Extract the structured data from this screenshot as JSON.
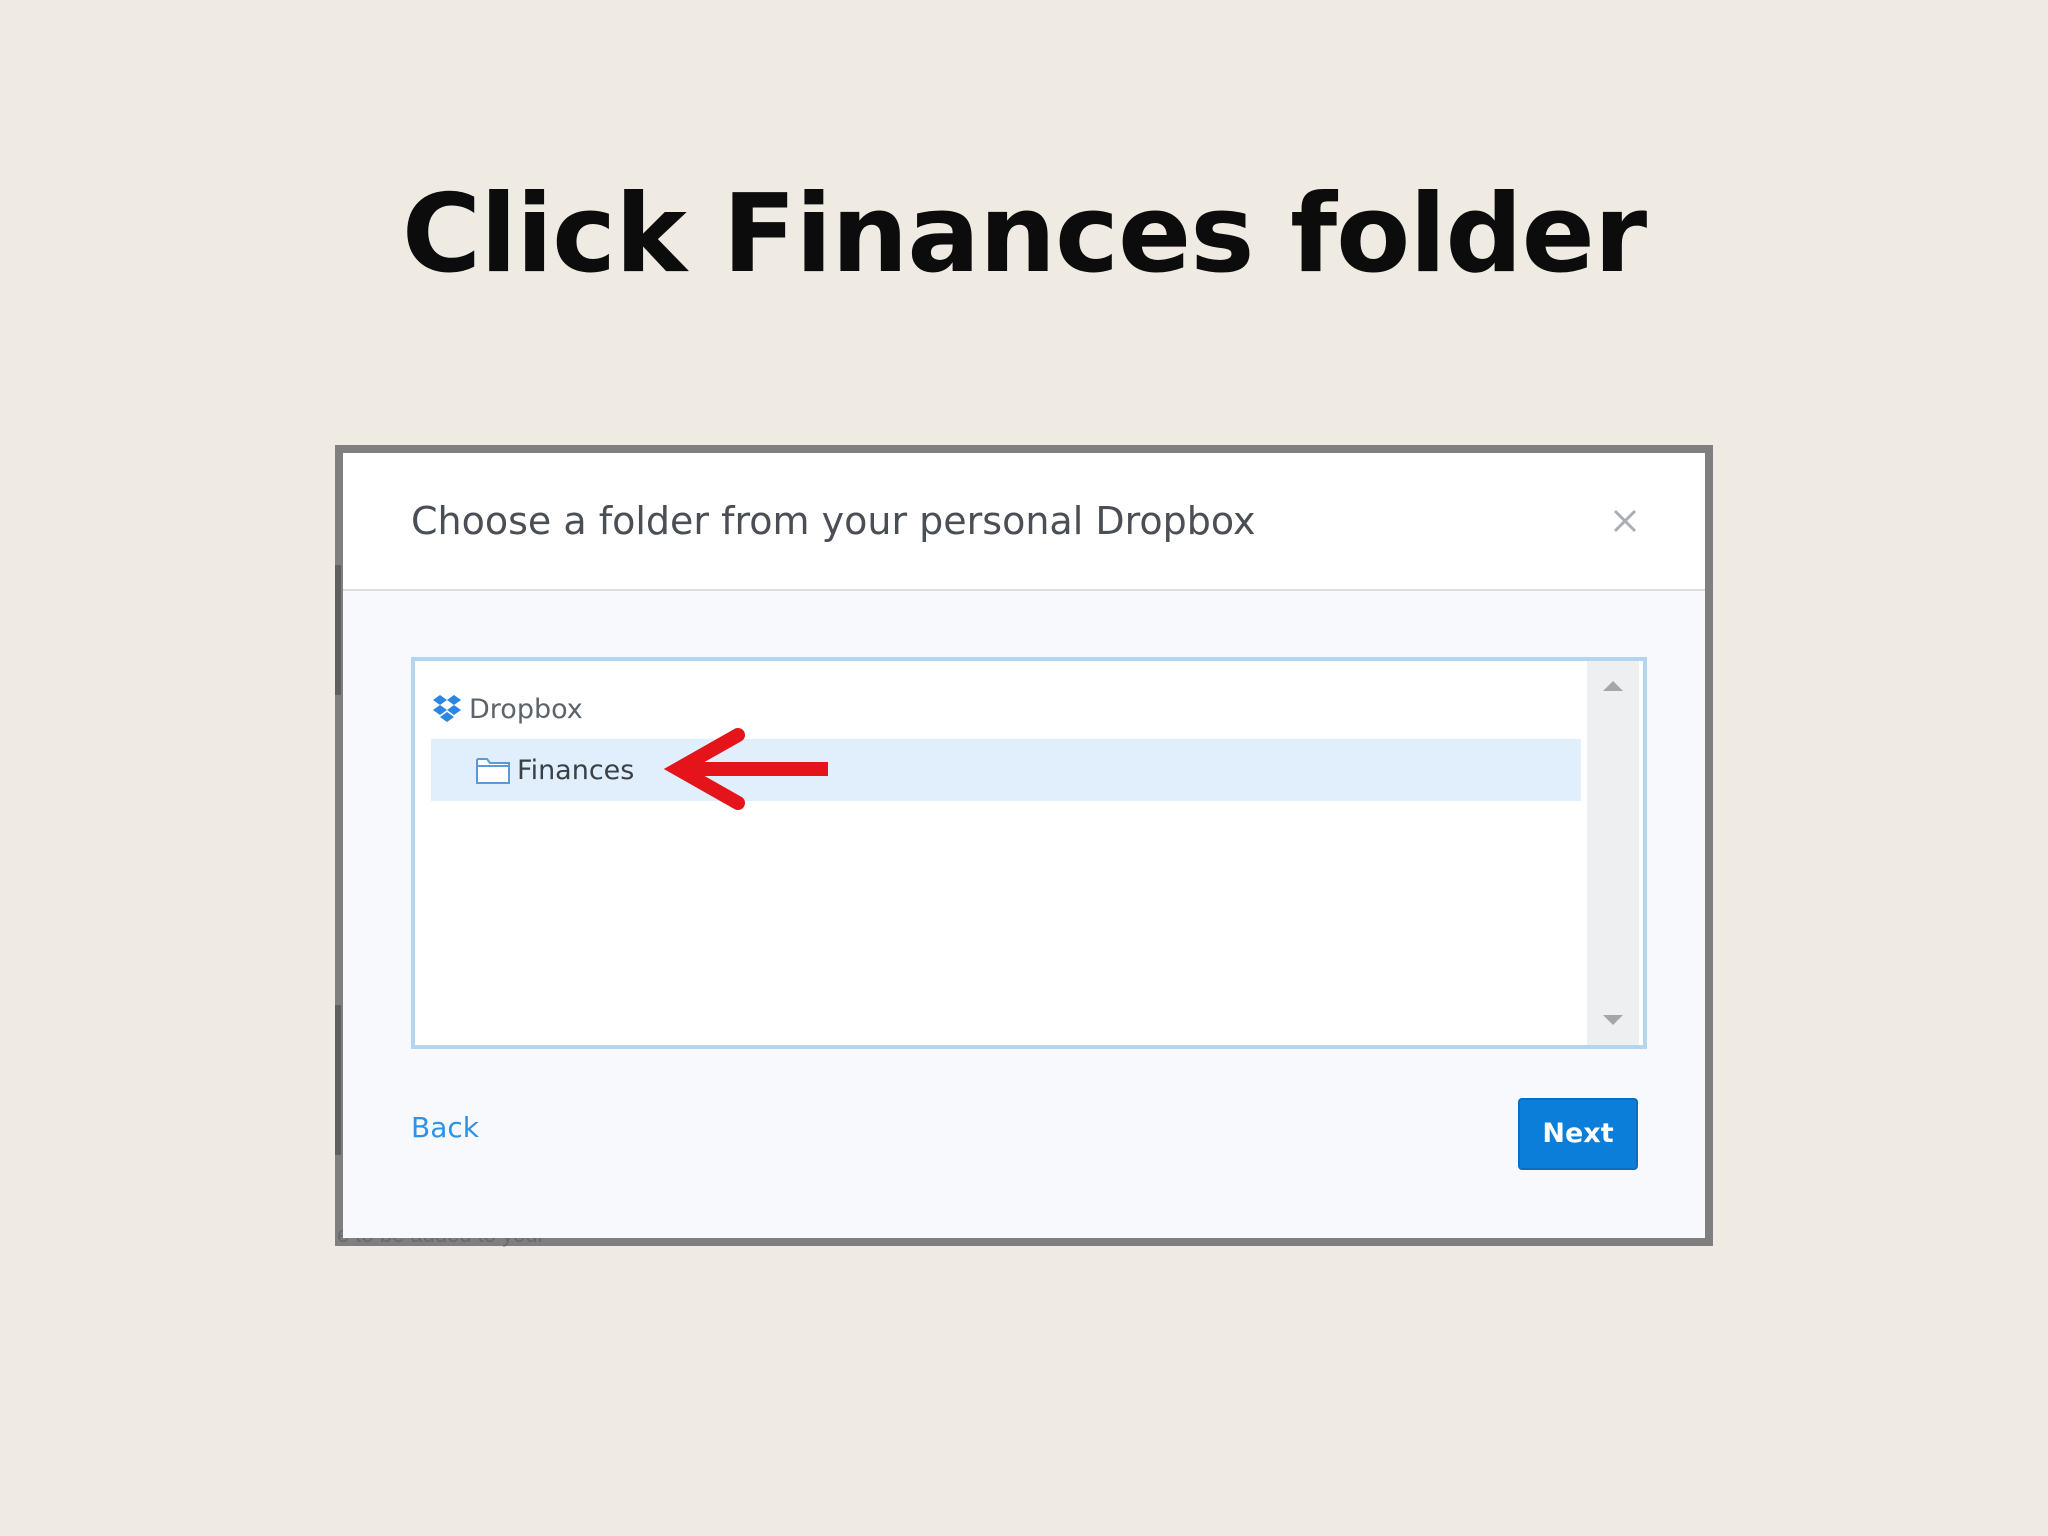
{
  "slide": {
    "title": "Click Finances folder"
  },
  "background_app": {
    "partial_text": "e to be added to your"
  },
  "dialog": {
    "title": "Choose a folder from your personal Dropbox",
    "close_icon": "close-icon",
    "tree": {
      "root": {
        "label": "Dropbox",
        "icon": "dropbox-icon"
      },
      "items": [
        {
          "label": "Finances",
          "icon": "folder-icon",
          "selected": true
        }
      ]
    },
    "back_label": "Back",
    "next_label": "Next"
  },
  "annotation": {
    "arrow_color": "#e5141a",
    "points_to": "Finances"
  },
  "colors": {
    "slide_background": "#efebe3",
    "accent_blue": "#0b7ed9",
    "link_blue": "#2e93e6",
    "selection_background": "#e1effc",
    "tree_border": "#b4d5f0"
  }
}
